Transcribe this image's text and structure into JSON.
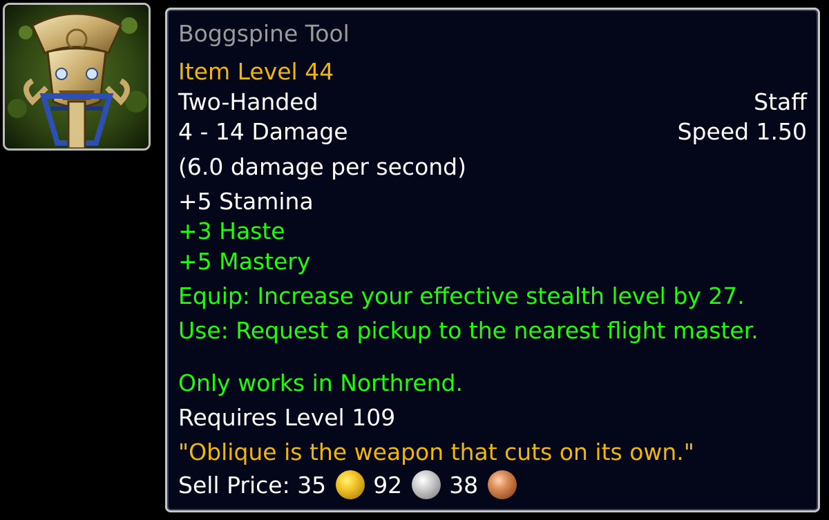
{
  "item": {
    "name": "Boggspine Tool",
    "item_level": "Item Level 44",
    "slot": "Two-Handed",
    "type": "Staff",
    "damage": "4 - 14 Damage",
    "speed": "Speed 1.50",
    "dps": "(6.0 damage per second)",
    "stats": {
      "stamina": "+5 Stamina",
      "haste": "+3 Haste",
      "mastery": "+5 Mastery"
    },
    "equip": "Equip: Increase your effective stealth level by 27.",
    "use": "Use: Request a pickup to the nearest flight master.",
    "restriction": "Only works in Northrend.",
    "requires": "Requires Level 109",
    "flavor": "\"Oblique is the weapon that cuts on its own.\"",
    "sell_price": {
      "label": "Sell Price: ",
      "gold": "35",
      "silver": "92",
      "copper": "38"
    }
  },
  "icon": "tiki-staff-icon",
  "colors": {
    "title": "#9a9a9a",
    "gold_text": "#f2b705",
    "white_text": "#ffffff",
    "green_text": "#1eff00",
    "tooltip_bg": "#04071a",
    "border": "#c6c6c6"
  }
}
